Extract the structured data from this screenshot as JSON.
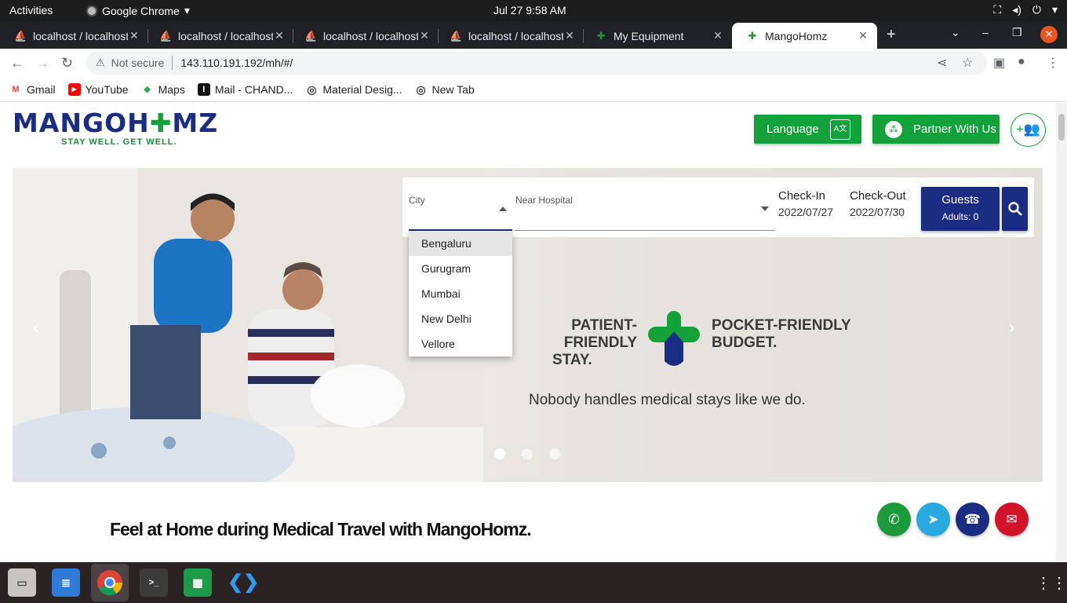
{
  "system": {
    "activities": "Activities",
    "app_name": "Google Chrome",
    "clock": "Jul 27   9:58 AM"
  },
  "tabs": [
    {
      "title": "localhost / localhost",
      "icon": "pma-icon"
    },
    {
      "title": "localhost / localhost",
      "icon": "pma-icon"
    },
    {
      "title": "localhost / localhost",
      "icon": "pma-icon"
    },
    {
      "title": "localhost / localhost",
      "icon": "pma-icon"
    },
    {
      "title": "My Equipment",
      "icon": "mango-icon"
    },
    {
      "title": "MangoHomz",
      "icon": "mango-icon",
      "active": true
    }
  ],
  "omnibox": {
    "security": "Not secure",
    "url": "143.110.191.192/mh/#/"
  },
  "bookmarks": [
    {
      "label": "Gmail",
      "color": "#ea4335",
      "glyph": "M"
    },
    {
      "label": "YouTube",
      "color": "#ff0000",
      "glyph": "▶"
    },
    {
      "label": "Maps",
      "color": "#34a853",
      "glyph": "◆"
    },
    {
      "label": "Mail - CHAND...",
      "color": "#111111",
      "glyph": "I"
    },
    {
      "label": "Material Desig...",
      "color": "#444444",
      "glyph": "◎"
    },
    {
      "label": "New Tab",
      "color": "#444444",
      "glyph": "◎"
    }
  ],
  "header": {
    "logo_left": "MANGOH",
    "logo_right": "MZ",
    "logo_tagline": "STAY WELL. GET WELL.",
    "language_label": "Language",
    "partner_label": "Partner With Us",
    "brand_green": "#13a23a",
    "brand_blue": "#1a2d82"
  },
  "search": {
    "city_label": "City",
    "near_label": "Near Hospital",
    "checkin_label": "Check-In",
    "checkin_value": "2022/07/27",
    "checkout_label": "Check-Out",
    "checkout_value": "2022/07/30",
    "guests_label": "Guests",
    "guests_value": "Adults: 0"
  },
  "city_options": [
    "Bengaluru",
    "Gurugram",
    "Mumbai",
    "New Delhi",
    "Vellore"
  ],
  "hero": {
    "tag_left_1": "PATIENT-FRIENDLY",
    "tag_left_2": "STAY.",
    "tag_right_1": "POCKET-FRIENDLY",
    "tag_right_2": "BUDGET.",
    "subtitle": "Nobody handles medical stays like we do."
  },
  "main": {
    "section_title": "Feel at Home during Medical Travel with MangoHomz."
  },
  "contact": [
    {
      "name": "whatsapp",
      "color": "#1c9a3b",
      "glyph": "✆"
    },
    {
      "name": "telegram",
      "color": "#2aa9e0",
      "glyph": "➤"
    },
    {
      "name": "phone",
      "color": "#1a2d82",
      "glyph": "☎"
    },
    {
      "name": "email",
      "color": "#d1142a",
      "glyph": "✉"
    }
  ]
}
